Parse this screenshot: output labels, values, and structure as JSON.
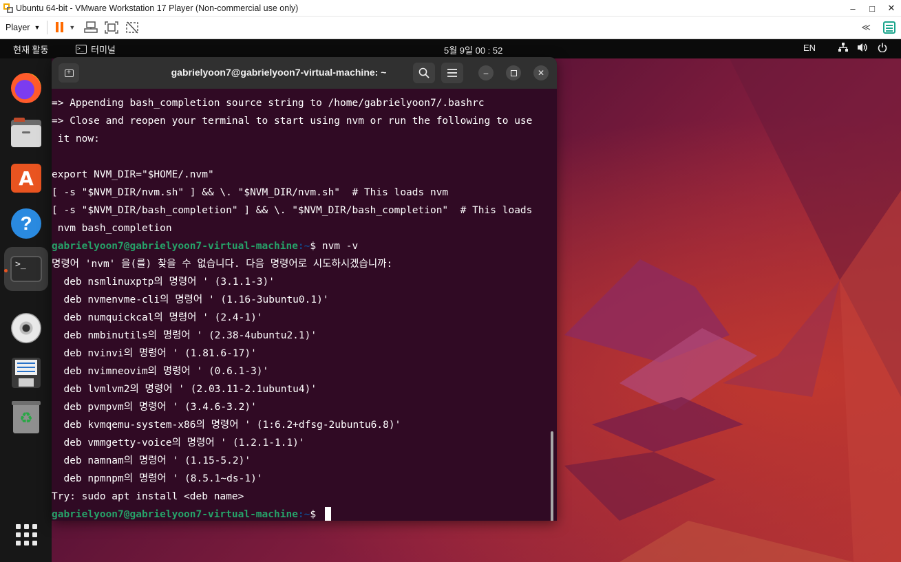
{
  "vmware": {
    "title": "Ubuntu 64-bit - VMware Workstation 17 Player (Non-commercial use only)",
    "player_menu": "Player",
    "accent_pause": "#ff6a00",
    "accent_library": "#1ba58c"
  },
  "top_panel": {
    "activities": "현재 활동",
    "app_name": "터미널",
    "clock": "5월 9일  00 : 52",
    "language": "EN",
    "tray_icons": [
      "network-icon",
      "volume-icon",
      "power-icon"
    ]
  },
  "dock": {
    "items": [
      "firefox-icon",
      "files-icon",
      "app-center-icon",
      "help-icon",
      "terminal-icon",
      "cd-drive-icon",
      "floppy-icon",
      "trash-icon"
    ],
    "show_apps": "apps-grid-icon"
  },
  "terminal": {
    "title": "gabrielyoon7@gabrielyoon7-virtual-machine: ~",
    "lines": [
      "=> Appending bash_completion source string to /home/gabrielyoon7/.bashrc",
      "=> Close and reopen your terminal to start using nvm or run the following to use",
      " it now:",
      "",
      "export NVM_DIR=\"$HOME/.nvm\"",
      "[ -s \"$NVM_DIR/nvm.sh\" ] && \\. \"$NVM_DIR/nvm.sh\"  # This loads nvm",
      "[ -s \"$NVM_DIR/bash_completion\" ] && \\. \"$NVM_DIR/bash_completion\"  # This loads",
      " nvm bash_completion"
    ],
    "prompt1": {
      "user": "gabrielyoon7@gabrielyoon7-virtual-machine",
      "path": ":~",
      "command": "$ nvm -v"
    },
    "output": [
      "명령어 'nvm' 을(를) 찾을 수 없습니다. 다음 명령어로 시도하시겠습니까:",
      "  deb nsmlinuxptp의 명령어 ' (3.1.1-3)'",
      "  deb nvmenvme-cli의 명령어 ' (1.16-3ubuntu0.1)'",
      "  deb numquickcal의 명령어 ' (2.4-1)'",
      "  deb nmbinutils의 명령어 ' (2.38-4ubuntu2.1)'",
      "  deb nvinvi의 명령어 ' (1.81.6-17)'",
      "  deb nvimneovim의 명령어 ' (0.6.1-3)'",
      "  deb lvmlvm2의 명령어 ' (2.03.11-2.1ubuntu4)'",
      "  deb pvmpvm의 명령어 ' (3.4.6-3.2)'",
      "  deb kvmqemu-system-x86의 명령어 ' (1:6.2+dfsg-2ubuntu6.8)'",
      "  deb vmmgetty-voice의 명령어 ' (1.2.1-1.1)'",
      "  deb namnam의 명령어 ' (1.15-5.2)'",
      "  deb npmnpm의 명령어 ' (8.5.1~ds-1)'",
      "Try: sudo apt install <deb name>"
    ],
    "prompt2": {
      "user": "gabrielyoon7@gabrielyoon7-virtual-machine",
      "path": ":~",
      "command": "$ "
    }
  },
  "colors": {
    "terminal_bg": "#300a24",
    "prompt_user": "#26a269",
    "prompt_path": "#12488b",
    "ubuntu_orange": "#e95420"
  }
}
